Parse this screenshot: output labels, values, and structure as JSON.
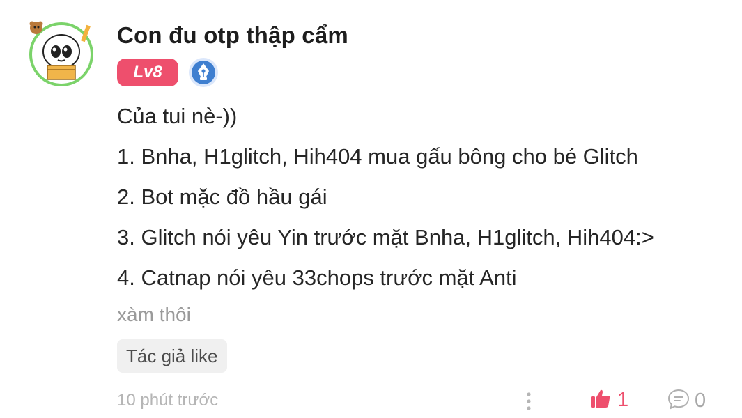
{
  "post": {
    "username": "Con đu otp thập cẩm",
    "level": "Lv8",
    "lines": [
      "Của tui nè-))",
      "1. Bnha, H1glitch, Hih404 mua gấu bông cho bé Glitch",
      "2. Bot mặc đồ hầu gái",
      "3. Glitch nói yêu Yin trước mặt Bnha, H1glitch, Hih404:>",
      "4. Catnap nói yêu 33chops trước mặt Anti"
    ],
    "note": "xàm thôi",
    "author_like_tag": "Tác giả like",
    "time": "10 phút trước",
    "likes": "1",
    "comments": "0"
  },
  "colors": {
    "accent": "#ee4f6d",
    "badge_blue": "#3f7fd0",
    "muted": "#9a9a9a"
  },
  "icons": {
    "avatar": "avatar",
    "level_badge": "level-badge",
    "pen_badge": "pen-nib-icon",
    "more": "more-vertical-icon",
    "like": "thumbs-up-icon",
    "comment": "comment-bubble-icon"
  }
}
